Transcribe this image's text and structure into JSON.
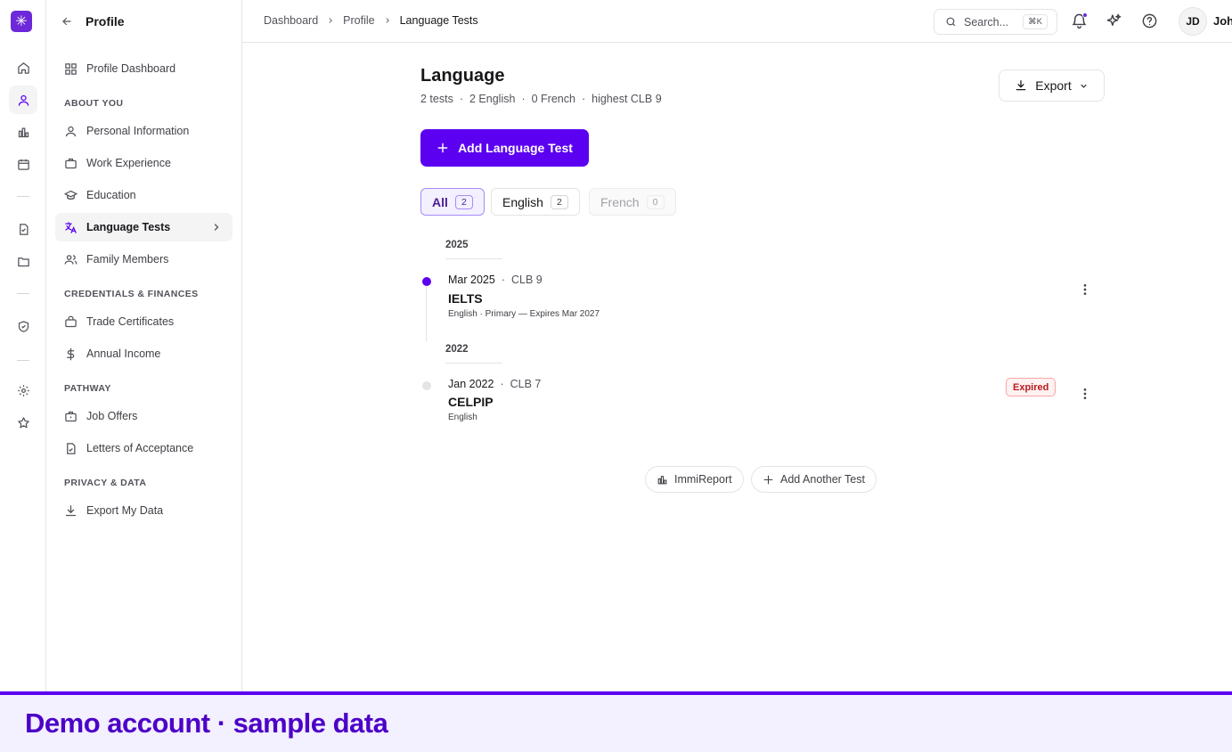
{
  "app": {
    "logo_glyph": "✳",
    "accent": "#5b00f0"
  },
  "sidebar": {
    "title": "Profile",
    "dashboard_label": "Profile Dashboard",
    "sections": {
      "about": "ABOUT YOU",
      "credentials": "CREDENTIALS & FINANCES",
      "pathway": "PATHWAY",
      "privacy": "PRIVACY & DATA"
    },
    "items": {
      "personal": "Personal Information",
      "work": "Work Experience",
      "education": "Education",
      "language": "Language Tests",
      "family": "Family Members",
      "trade": "Trade Certificates",
      "income": "Annual Income",
      "jobs": "Job Offers",
      "letters": "Letters of Acceptance",
      "export": "Export My Data"
    }
  },
  "topbar": {
    "breadcrumbs": [
      "Dashboard",
      "Profile",
      "Language Tests"
    ],
    "search_placeholder": "Search...",
    "search_shortcut": "⌘K",
    "avatar_initials": "JD",
    "username": "John"
  },
  "main": {
    "title": "Language",
    "summary": [
      "2 tests",
      "2 English",
      "0 French",
      "highest CLB 9"
    ],
    "export_label": "Export",
    "add_label": "Add Language Test",
    "filters": [
      {
        "label": "All",
        "count": "2"
      },
      {
        "label": "English",
        "count": "2"
      },
      {
        "label": "French",
        "count": "0"
      }
    ],
    "groups": [
      {
        "year": "2025",
        "entry": {
          "date": "Mar 2025",
          "clb": "CLB 9",
          "name": "IELTS",
          "desc": "English · Primary — Expires Mar 2027"
        }
      },
      {
        "year": "2022",
        "entry": {
          "date": "Jan 2022",
          "clb": "CLB 7",
          "name": "CELPIP",
          "desc": "English",
          "badge": "Expired"
        }
      }
    ],
    "footer_buttons": {
      "report": "ImmiReport",
      "add_another": "Add Another Test"
    }
  },
  "banner": {
    "text": "Demo account · sample data"
  },
  "icons": {
    "rail": [
      "home-icon",
      "user-icon",
      "chart-icon",
      "calendar-icon",
      "document-icon",
      "folder-icon",
      "shield-icon",
      "gear-icon",
      "star-icon"
    ],
    "topbar": [
      "bell-icon",
      "sparkles-icon",
      "help-icon"
    ]
  }
}
